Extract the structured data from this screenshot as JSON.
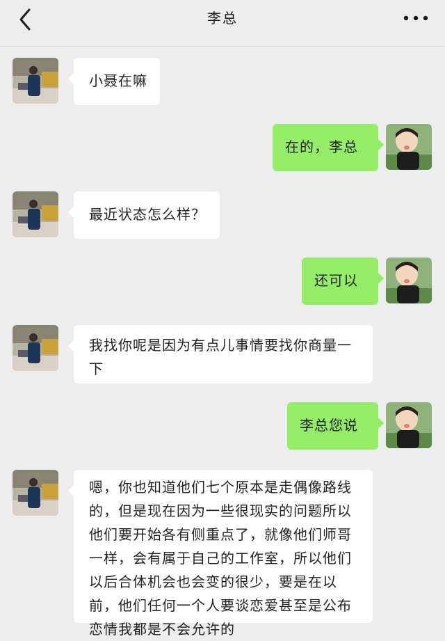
{
  "header": {
    "title": "李总",
    "back_icon": "chevron-left-icon",
    "more_icon": "more-dots-icon"
  },
  "colors": {
    "background": "#ededed",
    "incoming_bubble": "#ffffff",
    "outgoing_bubble": "#95ec69"
  },
  "messages": [
    {
      "side": "left",
      "text": "小聂在嘛"
    },
    {
      "side": "right",
      "text": "在的，李总"
    },
    {
      "side": "left",
      "text": "最近状态怎么样？"
    },
    {
      "side": "right",
      "text": "还可以"
    },
    {
      "side": "left",
      "text": "我找你呢是因为有点儿事情要找你商量一下"
    },
    {
      "side": "right",
      "text": "李总您说"
    },
    {
      "side": "left",
      "text": "嗯，你也知道他们七个原本是走偶像路线的，但是现在因为一些很现实的问题所以他们要开始各有侧重点了，就像他们师哥一样，会有属于自己的工作室，所以他们以后合体机会也会变的很少，要是在以前，他们任何一个人要谈恋爱甚至是公布恋情我都是不会允许的"
    }
  ]
}
